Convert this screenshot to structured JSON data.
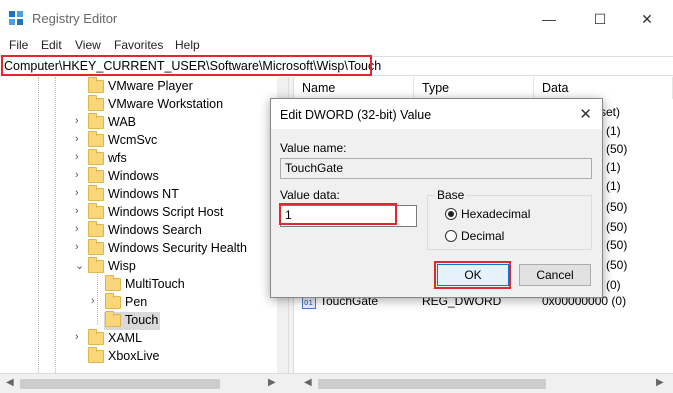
{
  "window": {
    "title": "Registry Editor",
    "minimize": "—",
    "maximize": "☐",
    "close": "✕"
  },
  "menu": [
    "File",
    "Edit",
    "View",
    "Favorites",
    "Help"
  ],
  "address": "Computer\\HKEY_CURRENT_USER\\Software\\Microsoft\\Wisp\\Touch",
  "tree": [
    {
      "label": "VMware Player",
      "expander": ""
    },
    {
      "label": "VMware Workstation",
      "expander": ""
    },
    {
      "label": "WAB",
      "expander": ">"
    },
    {
      "label": "WcmSvc",
      "expander": ">"
    },
    {
      "label": "wfs",
      "expander": ">"
    },
    {
      "label": "Windows",
      "expander": ">"
    },
    {
      "label": "Windows NT",
      "expander": ">"
    },
    {
      "label": "Windows Script Host",
      "expander": ">"
    },
    {
      "label": "Windows Search",
      "expander": ">"
    },
    {
      "label": "Windows Security Health",
      "expander": ">"
    },
    {
      "label": "Wisp",
      "expander": "v"
    },
    {
      "label": "MultiTouch",
      "expander": ""
    },
    {
      "label": "Pen",
      "expander": ">"
    },
    {
      "label": "Touch",
      "expander": ""
    },
    {
      "label": "XAML",
      "expander": ">"
    },
    {
      "label": "XboxLive",
      "expander": ""
    }
  ],
  "list": {
    "columns": [
      "Name",
      "Type",
      "Data"
    ],
    "data_fragments": [
      "set)",
      "(1)",
      "(50)",
      "(1)",
      "(1)",
      "(50)",
      "(50)",
      "(50)",
      "(50)",
      "(0)"
    ],
    "rows": [
      {
        "name": "TouchGate",
        "type": "REG_DWORD",
        "data": "0x00000000 (0)"
      }
    ]
  },
  "dialog": {
    "title": "Edit DWORD (32-bit) Value",
    "close": "✕",
    "value_name_label": "Value name:",
    "value_name": "TouchGate",
    "value_data_label": "Value data:",
    "value_data": "1",
    "base_label": "Base",
    "hex_label": "Hexadecimal",
    "dec_label": "Decimal",
    "ok": "OK",
    "cancel": "Cancel"
  },
  "colors": {
    "highlight": "#e0282e",
    "accent": "#0078d7",
    "folder": "#f9d67a"
  }
}
